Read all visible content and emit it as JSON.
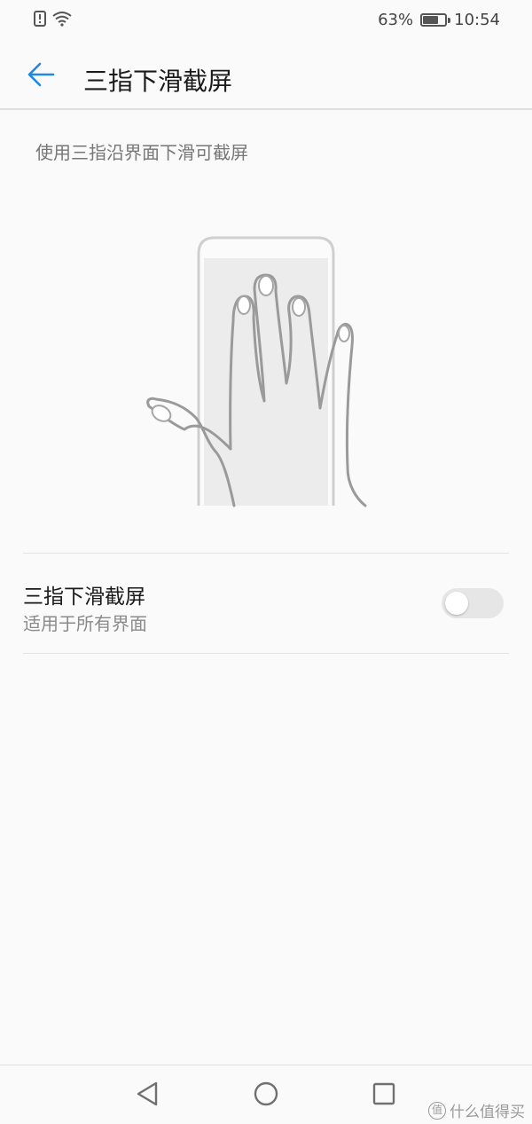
{
  "status_bar": {
    "battery_percent": "63%",
    "battery_level": 0.63,
    "time": "10:54",
    "icons": [
      "alert-icon",
      "wifi-icon",
      "battery-icon"
    ]
  },
  "header": {
    "title": "三指下滑截屏",
    "back_icon": "arrow-left-icon",
    "accent_color": "#1e88e5"
  },
  "main": {
    "description": "使用三指沿界面下滑可截屏",
    "illustration": "hand-three-finger-swipe-illustration",
    "setting": {
      "title": "三指下滑截屏",
      "subtitle": "适用于所有界面",
      "enabled": false
    }
  },
  "nav_bar": {
    "buttons": [
      "back-triangle-icon",
      "home-circle-icon",
      "recents-square-icon"
    ]
  },
  "watermark": {
    "badge": "值",
    "text": "什么值得买"
  }
}
